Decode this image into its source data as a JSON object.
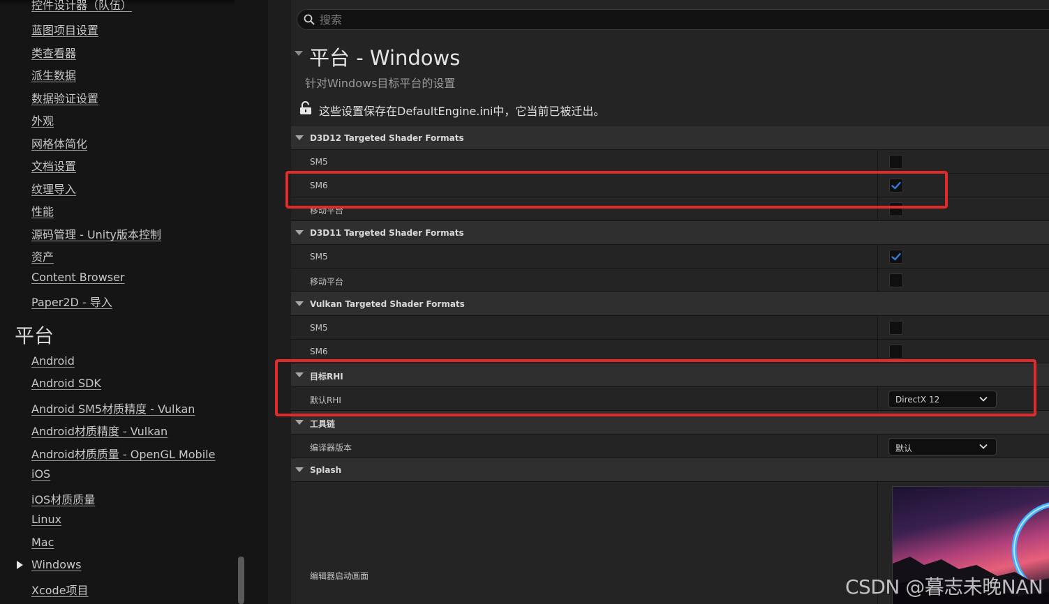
{
  "sidebar": {
    "items_top": [
      "控件设计器（队伍）",
      "蓝图项目设置",
      "类查看器",
      "派生数据",
      "数据验证设置",
      "外观",
      "网格体简化",
      "文档设置",
      "纹理导入",
      "性能",
      "源码管理 - Unity版本控制",
      "资产",
      "Content Browser",
      "Paper2D - 导入"
    ],
    "section_title": "平台",
    "platform_items": [
      "Android",
      "Android SDK",
      "Android SM5材质精度 - Vulkan",
      "Android材质精度 - Vulkan",
      "Android材质质量 - OpenGL Mobile",
      "iOS",
      "iOS材质质量",
      "Linux",
      "Mac",
      "Windows",
      "Xcode项目"
    ]
  },
  "search": {
    "placeholder": "搜索"
  },
  "header": {
    "title": "平台 - Windows",
    "subtitle": "针对Windows目标平台的设置",
    "config_note": "这些设置保存在DefaultEngine.ini中，它当前已被迁出。"
  },
  "categories": {
    "d3d12": {
      "label": "D3D12 Targeted Shader Formats",
      "sm5": "SM5",
      "sm5_checked": false,
      "sm6": "SM6",
      "sm6_checked": true,
      "mobile": "移动平台",
      "mobile_checked": false
    },
    "d3d11": {
      "label": "D3D11 Targeted Shader Formats",
      "sm5": "SM5",
      "sm5_checked": true,
      "mobile": "移动平台",
      "mobile_checked": false
    },
    "vulkan": {
      "label": "Vulkan Targeted Shader Formats",
      "sm5": "SM5",
      "sm5_checked": false,
      "sm6": "SM6",
      "sm6_checked": false
    },
    "rhi": {
      "label": "目标RHI",
      "default_rhi": "默认RHI",
      "default_rhi_value": "DirectX 12"
    },
    "toolchain": {
      "label": "工具链",
      "compiler_version": "编译器版本",
      "compiler_version_value": "默认"
    },
    "splash": {
      "label": "Splash",
      "editor_splash": "编辑器启动画面"
    }
  },
  "colors": {
    "accent_check": "#2f7de1",
    "annotation_red": "#e02b2b",
    "panel_bg": "#242424",
    "category_bg": "#2f2f2f"
  },
  "icons": [
    "search-icon",
    "lock-icon",
    "checkmark-icon",
    "chevron-down-icon",
    "expand-arrow-icon"
  ],
  "watermark": "CSDN @暮志未晚NAN"
}
